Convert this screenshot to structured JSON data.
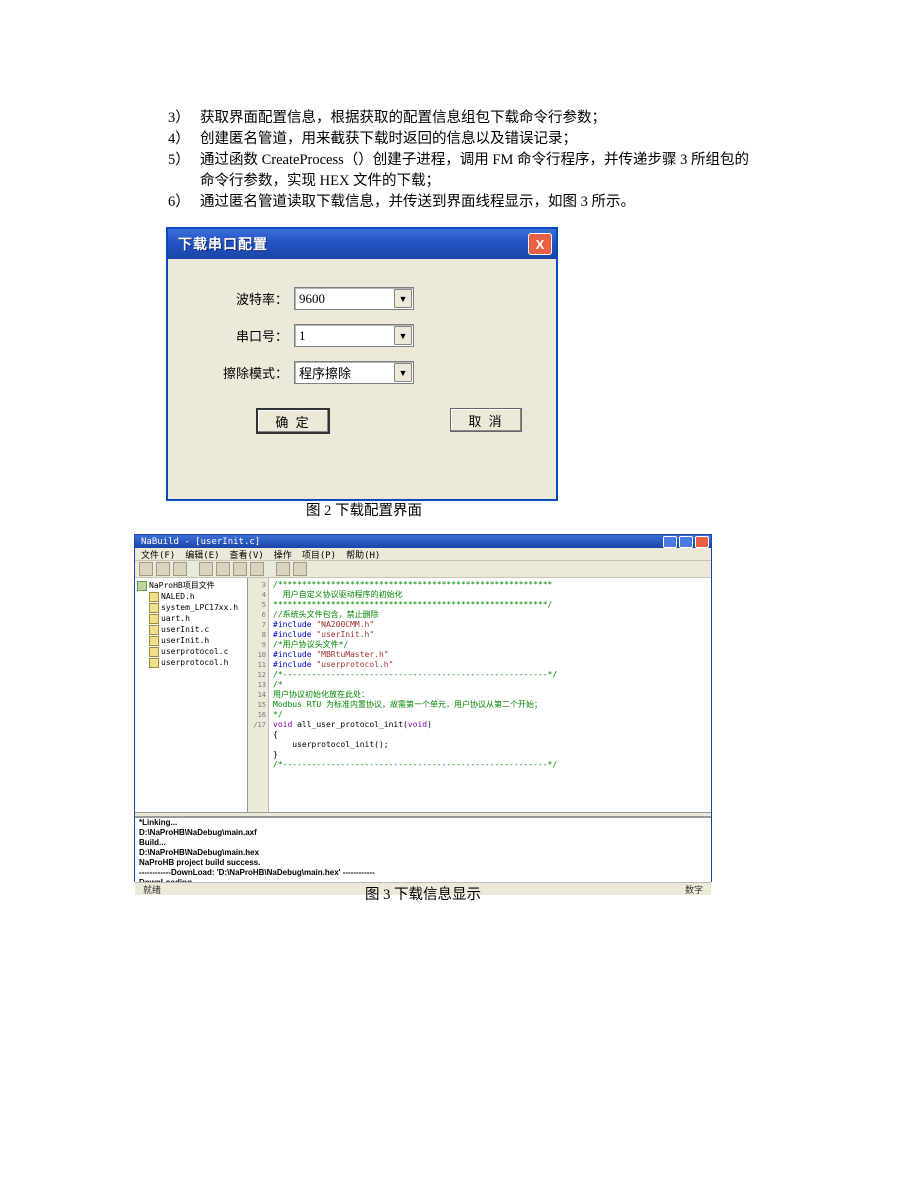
{
  "list": {
    "items": [
      {
        "num": "3）",
        "text": "获取界面配置信息，根据获取的配置信息组包下载命令行参数；"
      },
      {
        "num": "4）",
        "text": "创建匿名管道，用来截获下载时返回的信息以及错误记录；"
      },
      {
        "num": "5）",
        "text": "通过函数 CreateProcess（）创建子进程，调用 FM 命令行程序，并传递步骤 3 所组包的命令行参数，实现 HEX 文件的下载；"
      },
      {
        "num": "6）",
        "text": "通过匿名管道读取下载信息，并传送到界面线程显示，如图 3 所示。"
      }
    ]
  },
  "dialog": {
    "title": "下载串口配置",
    "close": "X",
    "labels": {
      "baud": "波特率：",
      "port": "串口号：",
      "erase": "擦除模式："
    },
    "values": {
      "baud": "9600",
      "port": "1",
      "erase": "程序擦除"
    },
    "ok": "确 定",
    "cancel": "取 消"
  },
  "caption2": "图 2  下载配置界面",
  "ide": {
    "title": "NaBuild - [userInit.c]",
    "menu": [
      "文件(F)",
      "编辑(E)",
      "查看(V)",
      "操作",
      "项目(P)",
      "帮助(H)"
    ],
    "tree": {
      "root": "NaProHB项目文件",
      "files": [
        "NALED.h",
        "system_LPC17xx.h",
        "uart.h",
        "userInit.c",
        "userInit.h",
        "userprotocol.c",
        "userprotocol.h"
      ]
    },
    "gutter": "3\n4\n5\n6\n7\n8\n9\n10\n11\n12\n13\n14\n15\n16\n/17\n\n\n\n",
    "code_lines": [
      {
        "cls": "c-green",
        "t": "/*********************************************************"
      },
      {
        "cls": "c-green",
        "t": "  用户自定义协议驱动程序的初始化"
      },
      {
        "cls": "c-green",
        "t": "*********************************************************/"
      },
      {
        "cls": "c-green",
        "t": "//系统头文件包含，禁止删除"
      },
      {
        "cls": "",
        "t": "<span class='c-blue'>#include</span> <span class='c-red'>\"NA200CMM.h\"</span>"
      },
      {
        "cls": "",
        "t": "<span class='c-blue'>#include</span> <span class='c-red'>\"userInit.h\"</span>"
      },
      {
        "cls": "c-green",
        "t": "/*用户协议头文件*/"
      },
      {
        "cls": "",
        "t": "<span class='c-blue'>#include</span> <span class='c-red'>\"MBRtuMaster.h\"</span>"
      },
      {
        "cls": "",
        "t": "<span class='c-blue'>#include</span> <span class='c-red'>\"userprotocol.h\"</span>"
      },
      {
        "cls": "c-green",
        "t": "/*-------------------------------------------------------*/"
      },
      {
        "cls": "c-green",
        "t": "/*"
      },
      {
        "cls": "c-green",
        "t": "用户协议初始化放在此处："
      },
      {
        "cls": "c-green",
        "t": "Modbus RTU 为标准内置协议，故需第一个单元，用户协议从第二个开始；"
      },
      {
        "cls": "c-green",
        "t": "*/"
      },
      {
        "cls": "",
        "t": "<span class='c-purple'>void</span> all_user_protocol_init(<span class='c-purple'>void</span>)"
      },
      {
        "cls": "",
        "t": "{"
      },
      {
        "cls": "",
        "t": "    userprotocol_init();"
      },
      {
        "cls": "",
        "t": ""
      },
      {
        "cls": "",
        "t": ""
      },
      {
        "cls": "",
        "t": "}"
      },
      {
        "cls": "c-green",
        "t": "/*-------------------------------------------------------*/"
      }
    ],
    "output": "*Linking...\nD:\\NaProHB\\NaDebug\\main.axf\nBuild...\nD:\\NaProHB\\NaDebug\\main.hex\nNaProHB project build success.\n------------DownLoad: 'D:\\NaProHB\\NaDebug\\main.hex' ------------\nDownLoading...\nNON PRODUCTION USE ONLY\nConnection failed: invalid command (Operation Failed.  Failed to autobaud - step 1. See http://www.flashmagictool.com/autobaud.html)",
    "status_left": "就绪",
    "status_right": "数字"
  },
  "caption3": "图 3  下载信息显示"
}
